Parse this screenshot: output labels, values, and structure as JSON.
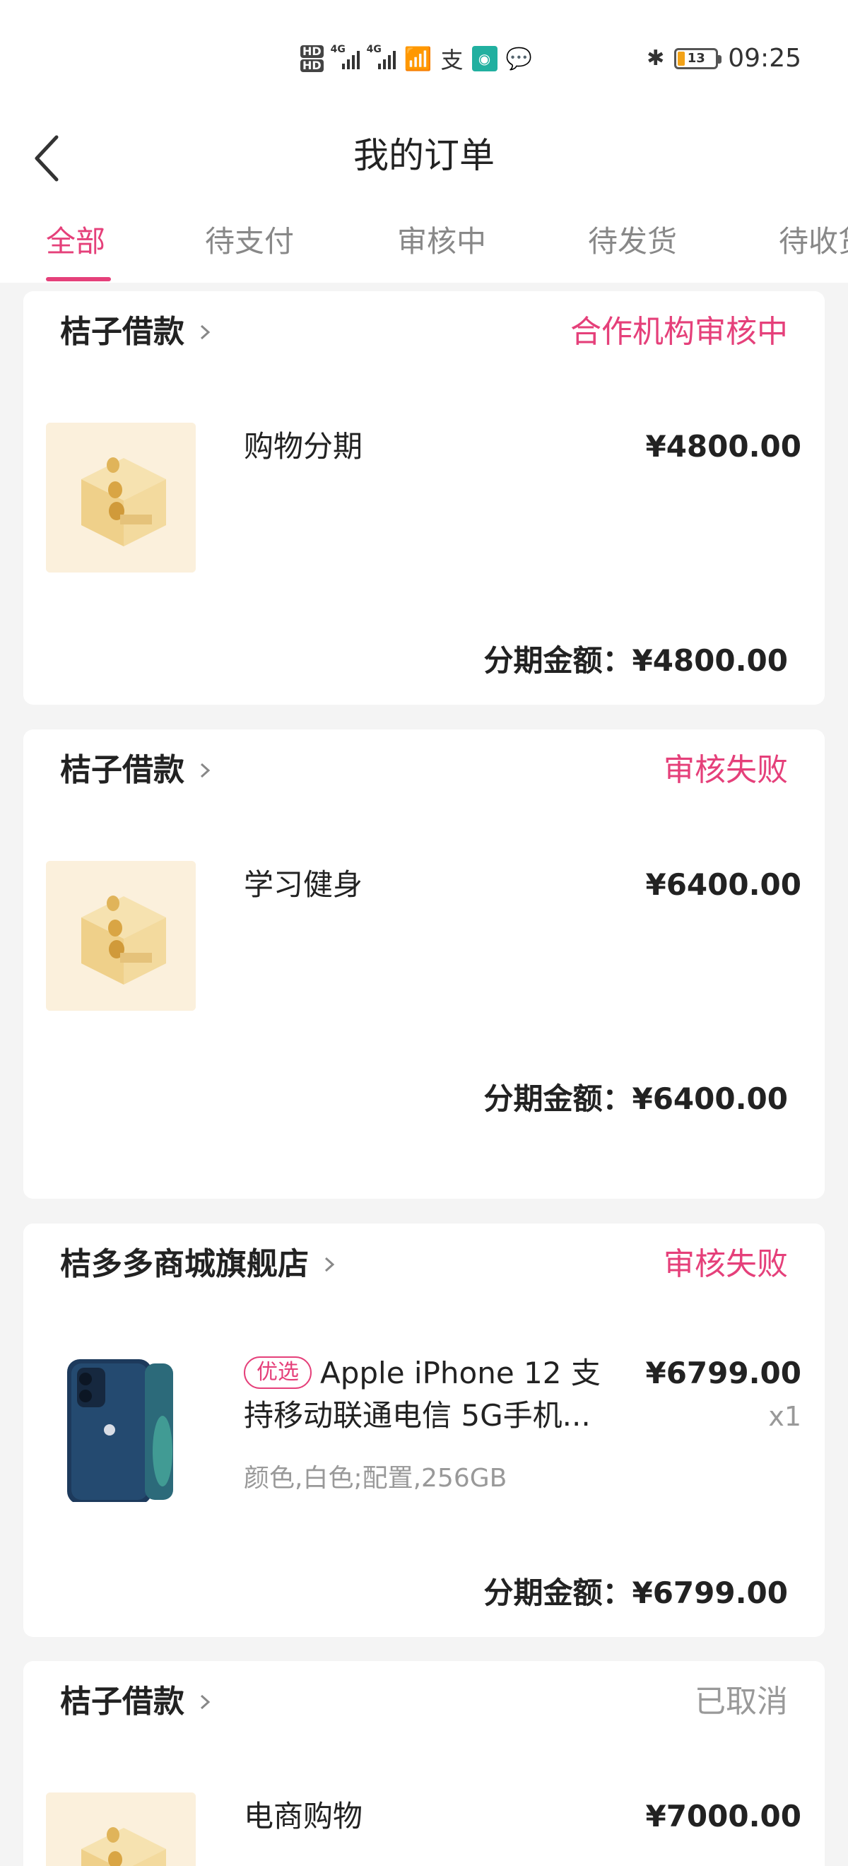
{
  "status_bar": {
    "network": "4G",
    "battery": "13",
    "time": "09:25"
  },
  "header": {
    "title": "我的订单"
  },
  "tabs": [
    {
      "label": "全部",
      "active": true
    },
    {
      "label": "待支付",
      "active": false
    },
    {
      "label": "审核中",
      "active": false
    },
    {
      "label": "待发货",
      "active": false
    },
    {
      "label": "待收货",
      "active": false
    }
  ],
  "orders": [
    {
      "store": "桔子借款",
      "status": "合作机构审核中",
      "item": "购物分期",
      "price": "¥4800.00",
      "total_label": "分期金额：",
      "total": "¥4800.00"
    },
    {
      "store": "桔子借款",
      "status": "审核失败",
      "item": "学习健身",
      "price": "¥6400.00",
      "total_label": "分期金额：",
      "total": "¥6400.00"
    },
    {
      "store": "桔多多商城旗舰店",
      "status": "审核失败",
      "tag": "优选",
      "item": "Apple iPhone 12 支持移动联通电信 5G手机...",
      "spec": "颜色,白色;配置,256GB",
      "price": "¥6799.00",
      "qty": "x1",
      "total_label": "分期金额：",
      "total": "¥6799.00"
    },
    {
      "store": "桔子借款",
      "status": "已取消",
      "item": "电商购物",
      "price": "¥7000.00"
    }
  ]
}
